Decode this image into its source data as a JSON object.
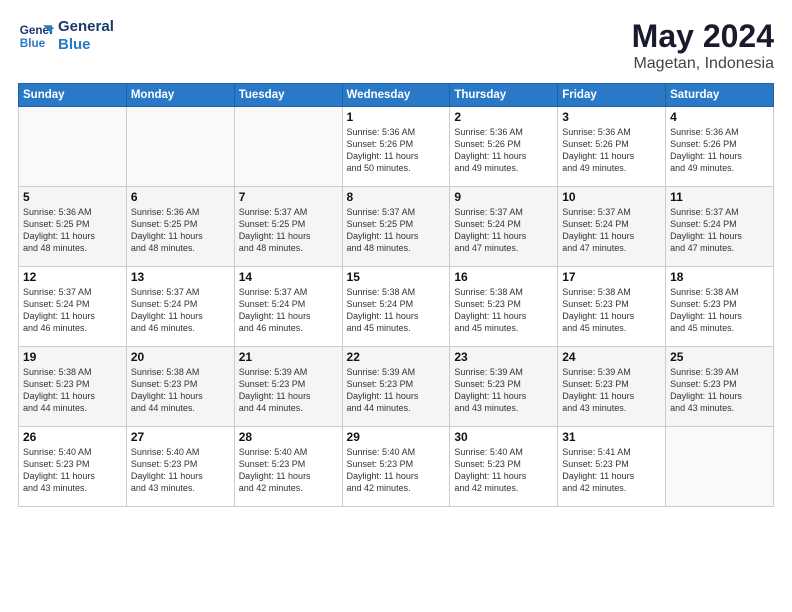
{
  "header": {
    "logo_line1": "General",
    "logo_line2": "Blue",
    "month_year": "May 2024",
    "location": "Magetan, Indonesia"
  },
  "weekdays": [
    "Sunday",
    "Monday",
    "Tuesday",
    "Wednesday",
    "Thursday",
    "Friday",
    "Saturday"
  ],
  "weeks": [
    [
      {
        "day": "",
        "info": ""
      },
      {
        "day": "",
        "info": ""
      },
      {
        "day": "",
        "info": ""
      },
      {
        "day": "1",
        "info": "Sunrise: 5:36 AM\nSunset: 5:26 PM\nDaylight: 11 hours\nand 50 minutes."
      },
      {
        "day": "2",
        "info": "Sunrise: 5:36 AM\nSunset: 5:26 PM\nDaylight: 11 hours\nand 49 minutes."
      },
      {
        "day": "3",
        "info": "Sunrise: 5:36 AM\nSunset: 5:26 PM\nDaylight: 11 hours\nand 49 minutes."
      },
      {
        "day": "4",
        "info": "Sunrise: 5:36 AM\nSunset: 5:26 PM\nDaylight: 11 hours\nand 49 minutes."
      }
    ],
    [
      {
        "day": "5",
        "info": "Sunrise: 5:36 AM\nSunset: 5:25 PM\nDaylight: 11 hours\nand 48 minutes."
      },
      {
        "day": "6",
        "info": "Sunrise: 5:36 AM\nSunset: 5:25 PM\nDaylight: 11 hours\nand 48 minutes."
      },
      {
        "day": "7",
        "info": "Sunrise: 5:37 AM\nSunset: 5:25 PM\nDaylight: 11 hours\nand 48 minutes."
      },
      {
        "day": "8",
        "info": "Sunrise: 5:37 AM\nSunset: 5:25 PM\nDaylight: 11 hours\nand 48 minutes."
      },
      {
        "day": "9",
        "info": "Sunrise: 5:37 AM\nSunset: 5:24 PM\nDaylight: 11 hours\nand 47 minutes."
      },
      {
        "day": "10",
        "info": "Sunrise: 5:37 AM\nSunset: 5:24 PM\nDaylight: 11 hours\nand 47 minutes."
      },
      {
        "day": "11",
        "info": "Sunrise: 5:37 AM\nSunset: 5:24 PM\nDaylight: 11 hours\nand 47 minutes."
      }
    ],
    [
      {
        "day": "12",
        "info": "Sunrise: 5:37 AM\nSunset: 5:24 PM\nDaylight: 11 hours\nand 46 minutes."
      },
      {
        "day": "13",
        "info": "Sunrise: 5:37 AM\nSunset: 5:24 PM\nDaylight: 11 hours\nand 46 minutes."
      },
      {
        "day": "14",
        "info": "Sunrise: 5:37 AM\nSunset: 5:24 PM\nDaylight: 11 hours\nand 46 minutes."
      },
      {
        "day": "15",
        "info": "Sunrise: 5:38 AM\nSunset: 5:24 PM\nDaylight: 11 hours\nand 45 minutes."
      },
      {
        "day": "16",
        "info": "Sunrise: 5:38 AM\nSunset: 5:23 PM\nDaylight: 11 hours\nand 45 minutes."
      },
      {
        "day": "17",
        "info": "Sunrise: 5:38 AM\nSunset: 5:23 PM\nDaylight: 11 hours\nand 45 minutes."
      },
      {
        "day": "18",
        "info": "Sunrise: 5:38 AM\nSunset: 5:23 PM\nDaylight: 11 hours\nand 45 minutes."
      }
    ],
    [
      {
        "day": "19",
        "info": "Sunrise: 5:38 AM\nSunset: 5:23 PM\nDaylight: 11 hours\nand 44 minutes."
      },
      {
        "day": "20",
        "info": "Sunrise: 5:38 AM\nSunset: 5:23 PM\nDaylight: 11 hours\nand 44 minutes."
      },
      {
        "day": "21",
        "info": "Sunrise: 5:39 AM\nSunset: 5:23 PM\nDaylight: 11 hours\nand 44 minutes."
      },
      {
        "day": "22",
        "info": "Sunrise: 5:39 AM\nSunset: 5:23 PM\nDaylight: 11 hours\nand 44 minutes."
      },
      {
        "day": "23",
        "info": "Sunrise: 5:39 AM\nSunset: 5:23 PM\nDaylight: 11 hours\nand 43 minutes."
      },
      {
        "day": "24",
        "info": "Sunrise: 5:39 AM\nSunset: 5:23 PM\nDaylight: 11 hours\nand 43 minutes."
      },
      {
        "day": "25",
        "info": "Sunrise: 5:39 AM\nSunset: 5:23 PM\nDaylight: 11 hours\nand 43 minutes."
      }
    ],
    [
      {
        "day": "26",
        "info": "Sunrise: 5:40 AM\nSunset: 5:23 PM\nDaylight: 11 hours\nand 43 minutes."
      },
      {
        "day": "27",
        "info": "Sunrise: 5:40 AM\nSunset: 5:23 PM\nDaylight: 11 hours\nand 43 minutes."
      },
      {
        "day": "28",
        "info": "Sunrise: 5:40 AM\nSunset: 5:23 PM\nDaylight: 11 hours\nand 42 minutes."
      },
      {
        "day": "29",
        "info": "Sunrise: 5:40 AM\nSunset: 5:23 PM\nDaylight: 11 hours\nand 42 minutes."
      },
      {
        "day": "30",
        "info": "Sunrise: 5:40 AM\nSunset: 5:23 PM\nDaylight: 11 hours\nand 42 minutes."
      },
      {
        "day": "31",
        "info": "Sunrise: 5:41 AM\nSunset: 5:23 PM\nDaylight: 11 hours\nand 42 minutes."
      },
      {
        "day": "",
        "info": ""
      }
    ]
  ]
}
